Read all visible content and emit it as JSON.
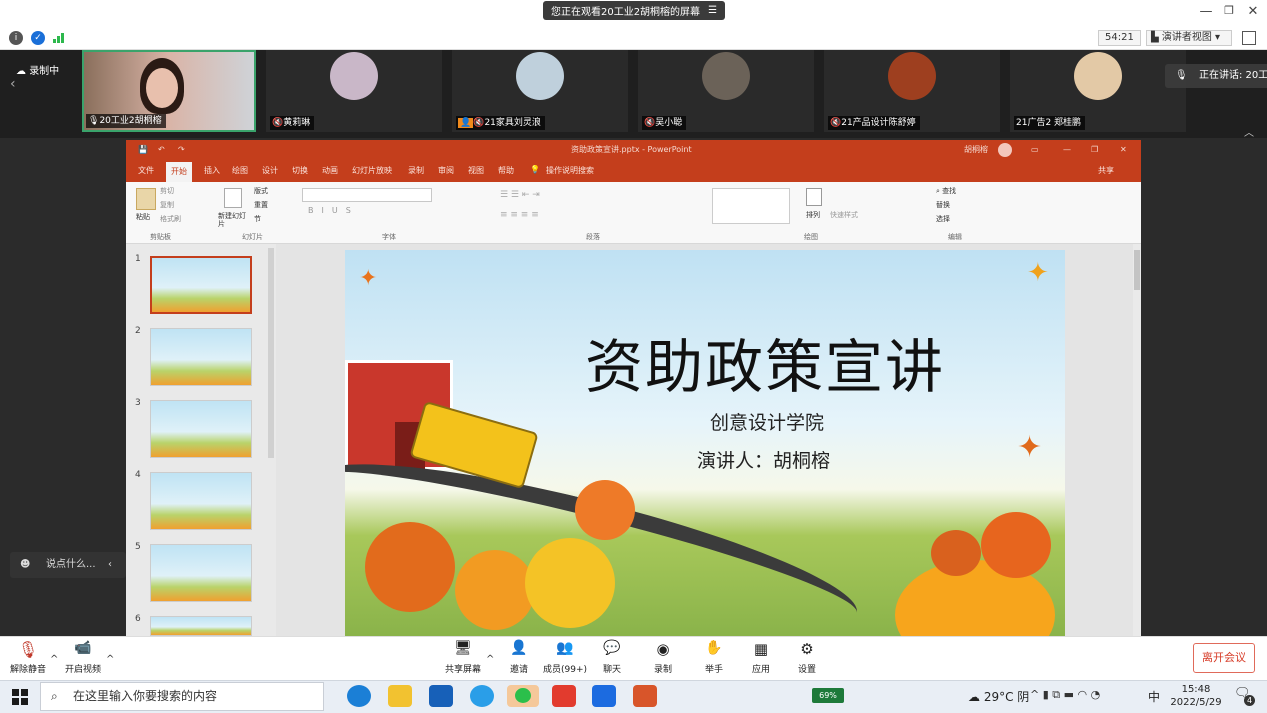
{
  "top": {
    "banner": "您正在观看20工业2胡桐榕的屏幕"
  },
  "info": {
    "timer": "54:21",
    "view_mode": "演讲者视图"
  },
  "strip": {
    "recording": "录制中",
    "self_name": "20工业2胡桐榕",
    "participants": [
      {
        "name": "黄莉琳",
        "color": "#c9b7c8"
      },
      {
        "name": "21家具刘灵浪",
        "color": "#bfd0dc"
      },
      {
        "name": "吴小聪",
        "color": "#6b6258"
      },
      {
        "name": "21产品设计陈舒婷",
        "color": "#9e3f1f"
      },
      {
        "name": "21广告2 郑桂鹏",
        "color": "#e3c9a6"
      }
    ],
    "speaking": "正在讲话: 20工"
  },
  "ppt": {
    "title": "资助政策宣讲.pptx - PowerPoint",
    "user": "胡桐榕",
    "tabs": [
      "文件",
      "开始",
      "插入",
      "绘图",
      "设计",
      "切换",
      "动画",
      "幻灯片放映",
      "录制",
      "审阅",
      "视图",
      "帮助"
    ],
    "tell_me": "操作说明搜索",
    "share": "共享",
    "groups": [
      "剪贴板",
      "幻灯片",
      "字体",
      "段落",
      "绘图",
      "编辑"
    ],
    "ribbon_items": {
      "paste": "粘贴",
      "cut": "剪切",
      "copy": "复制",
      "format_painter": "格式刷",
      "new_slide": "新建幻灯片",
      "layout": "版式",
      "reset": "重置",
      "section": "节",
      "arrange": "排列",
      "quick_styles": "快速样式",
      "find": "查找",
      "replace": "替换",
      "select": "选择"
    },
    "slide_numbers": [
      "1",
      "2",
      "3",
      "4",
      "5",
      "6"
    ],
    "slide": {
      "title": "资助政策宣讲",
      "subtitle1": "创意设计学院",
      "subtitle2": "演讲人：胡桐榕"
    }
  },
  "chat": {
    "placeholder": "说点什么..."
  },
  "controls": {
    "unmute": "解除静音",
    "video": "开启视频",
    "share_screen": "共享屏幕",
    "invite": "邀请",
    "members": "成员(99+)",
    "chat": "聊天",
    "record": "录制",
    "raise_hand": "举手",
    "apps": "应用",
    "settings": "设置",
    "leave": "离开会议"
  },
  "taskbar": {
    "search_placeholder": "在这里输入你要搜索的内容",
    "battery": "69%",
    "weather": "29°C 阴",
    "ime": "中",
    "time": "15:48",
    "date": "2022/5/29",
    "notifications": "4"
  }
}
